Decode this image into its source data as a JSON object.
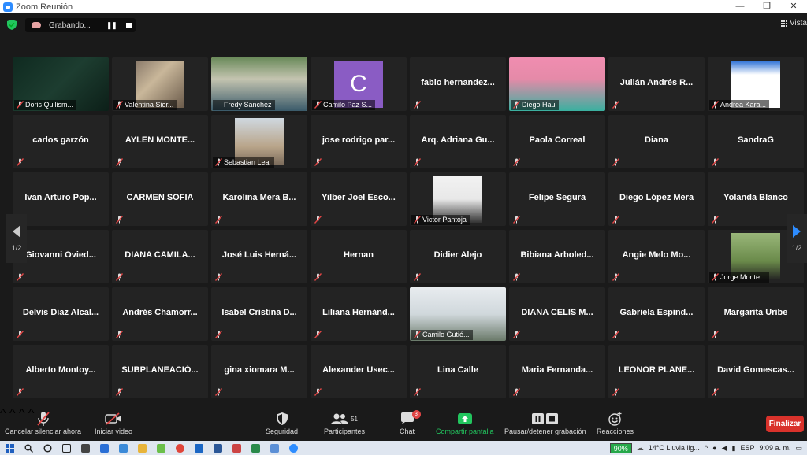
{
  "window": {
    "title": "Zoom Reunión",
    "minimize": "—",
    "restore": "❐",
    "close": "✕"
  },
  "top": {
    "recording_label": "Grabando...",
    "pause_glyph": "❚❚",
    "view_label": "Vista"
  },
  "pager": {
    "left": "1/2",
    "right": "1/2"
  },
  "participants": [
    {
      "name": "Doris Quilism...",
      "kind": "video"
    },
    {
      "name": "Valentina Sier...",
      "kind": "video"
    },
    {
      "name": "Fredy Sanchez",
      "kind": "video"
    },
    {
      "name": "Camilo Paz S...",
      "kind": "avatar",
      "initial": "C"
    },
    {
      "name": "fabio  hernandez...",
      "kind": "text"
    },
    {
      "name": "Diego Hau",
      "kind": "video"
    },
    {
      "name": "Julián Andrés R...",
      "kind": "text"
    },
    {
      "name": "Andrea Kara...",
      "kind": "video"
    },
    {
      "name": "carlos garzón",
      "kind": "text"
    },
    {
      "name": "AYLEN  MONTE...",
      "kind": "text"
    },
    {
      "name": "Sebastian Leal",
      "kind": "video"
    },
    {
      "name": "jose  rodrigo  par...",
      "kind": "text"
    },
    {
      "name": "Arq. Adriana  Gu...",
      "kind": "text"
    },
    {
      "name": "Paola Correal",
      "kind": "text"
    },
    {
      "name": "Diana",
      "kind": "text"
    },
    {
      "name": "SandraG",
      "kind": "text"
    },
    {
      "name": "Ivan  Arturo  Pop...",
      "kind": "text"
    },
    {
      "name": "CARMEN SOFIA",
      "kind": "text"
    },
    {
      "name": "Karolina  Mera  B...",
      "kind": "text"
    },
    {
      "name": "Yilber  Joel  Esco...",
      "kind": "text"
    },
    {
      "name": "Victor Pantoja",
      "kind": "video"
    },
    {
      "name": "Felipe Segura",
      "kind": "text"
    },
    {
      "name": "Diego López Mera",
      "kind": "text"
    },
    {
      "name": "Yolanda  Blanco",
      "kind": "text"
    },
    {
      "name": "Giovanni  Ovied...",
      "kind": "text"
    },
    {
      "name": "DIANA  CAMILA...",
      "kind": "text"
    },
    {
      "name": "José Luis  Herná...",
      "kind": "text"
    },
    {
      "name": "Hernan",
      "kind": "text"
    },
    {
      "name": "Didier Alejo",
      "kind": "text"
    },
    {
      "name": "Bibiana  Arboled...",
      "kind": "text"
    },
    {
      "name": "Angie  Melo  Mo...",
      "kind": "text"
    },
    {
      "name": "Jorge Monte...",
      "kind": "video"
    },
    {
      "name": "Delvis  Diaz  Alcal...",
      "kind": "text"
    },
    {
      "name": "Andrés  Chamorr...",
      "kind": "text"
    },
    {
      "name": "Isabel Cristina  D...",
      "kind": "text"
    },
    {
      "name": "Liliana  Hernánd...",
      "kind": "text"
    },
    {
      "name": "Camilo Gutié...",
      "kind": "video"
    },
    {
      "name": "DIANA CELIS M...",
      "kind": "text"
    },
    {
      "name": "Gabriela  Espind...",
      "kind": "text"
    },
    {
      "name": "Margarita Uribe",
      "kind": "text"
    },
    {
      "name": "Alberto  Montoy...",
      "kind": "text"
    },
    {
      "name": "SUBPLANEACIÓ...",
      "kind": "text"
    },
    {
      "name": "gina  xiomara  M...",
      "kind": "text"
    },
    {
      "name": "Alexander  Usec...",
      "kind": "text"
    },
    {
      "name": "Lina Calle",
      "kind": "text"
    },
    {
      "name": "Maria  Fernanda...",
      "kind": "text"
    },
    {
      "name": "LEONOR  PLANE...",
      "kind": "text"
    },
    {
      "name": "David  Gomescas...",
      "kind": "text"
    }
  ],
  "toolbar": {
    "unmute": "Cancelar silenciar ahora",
    "start_video": "Iniciar video",
    "security": "Seguridad",
    "participants": "Participantes",
    "participants_count": "51",
    "chat": "Chat",
    "chat_badge": "3",
    "share": "Compartir pantalla",
    "recording": "Pausar/detener grabación",
    "reactions": "Reacciones",
    "end": "Finalizar"
  },
  "taskbar": {
    "battery": "90%",
    "weather": "14°C  Lluvia lig...",
    "lang": "ESP",
    "time": "9:09 a. m."
  },
  "colors": {
    "active_speaker": "#f2e57a",
    "share_green": "#22c55e",
    "end_red": "#d9322b",
    "muted_red": "#e04545"
  }
}
